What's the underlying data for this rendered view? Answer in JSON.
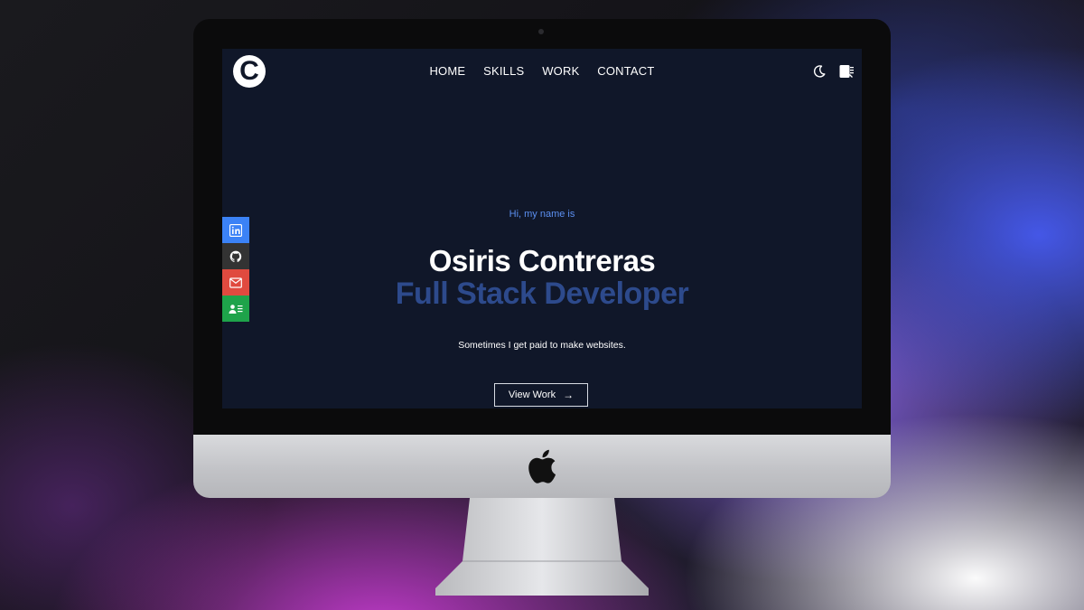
{
  "site": {
    "logo_letter": "C",
    "nav": [
      "HOME",
      "SKILLS",
      "WORK",
      "CONTACT"
    ],
    "header_icons": [
      "moon-icon",
      "resume-icon"
    ]
  },
  "social": [
    {
      "name": "linkedin",
      "icon": "linkedin-icon",
      "color": "#3b82f6"
    },
    {
      "name": "github",
      "icon": "github-icon",
      "color": "#333333"
    },
    {
      "name": "email",
      "icon": "mail-icon",
      "color": "#e04a3f"
    },
    {
      "name": "contact",
      "icon": "contact-card-icon",
      "color": "#1ea34a"
    }
  ],
  "hero": {
    "intro": "Hi, my name is",
    "name": "Osiris Contreras",
    "role": "Full Stack Developer",
    "tagline": "Sometimes I get paid to make websites.",
    "cta_label": "View Work",
    "cta_icon": "arrow-right-icon"
  },
  "colors": {
    "screen_bg": "#101729",
    "accent_blue": "#5b8ff0",
    "role_blue": "#2d4a8c"
  }
}
